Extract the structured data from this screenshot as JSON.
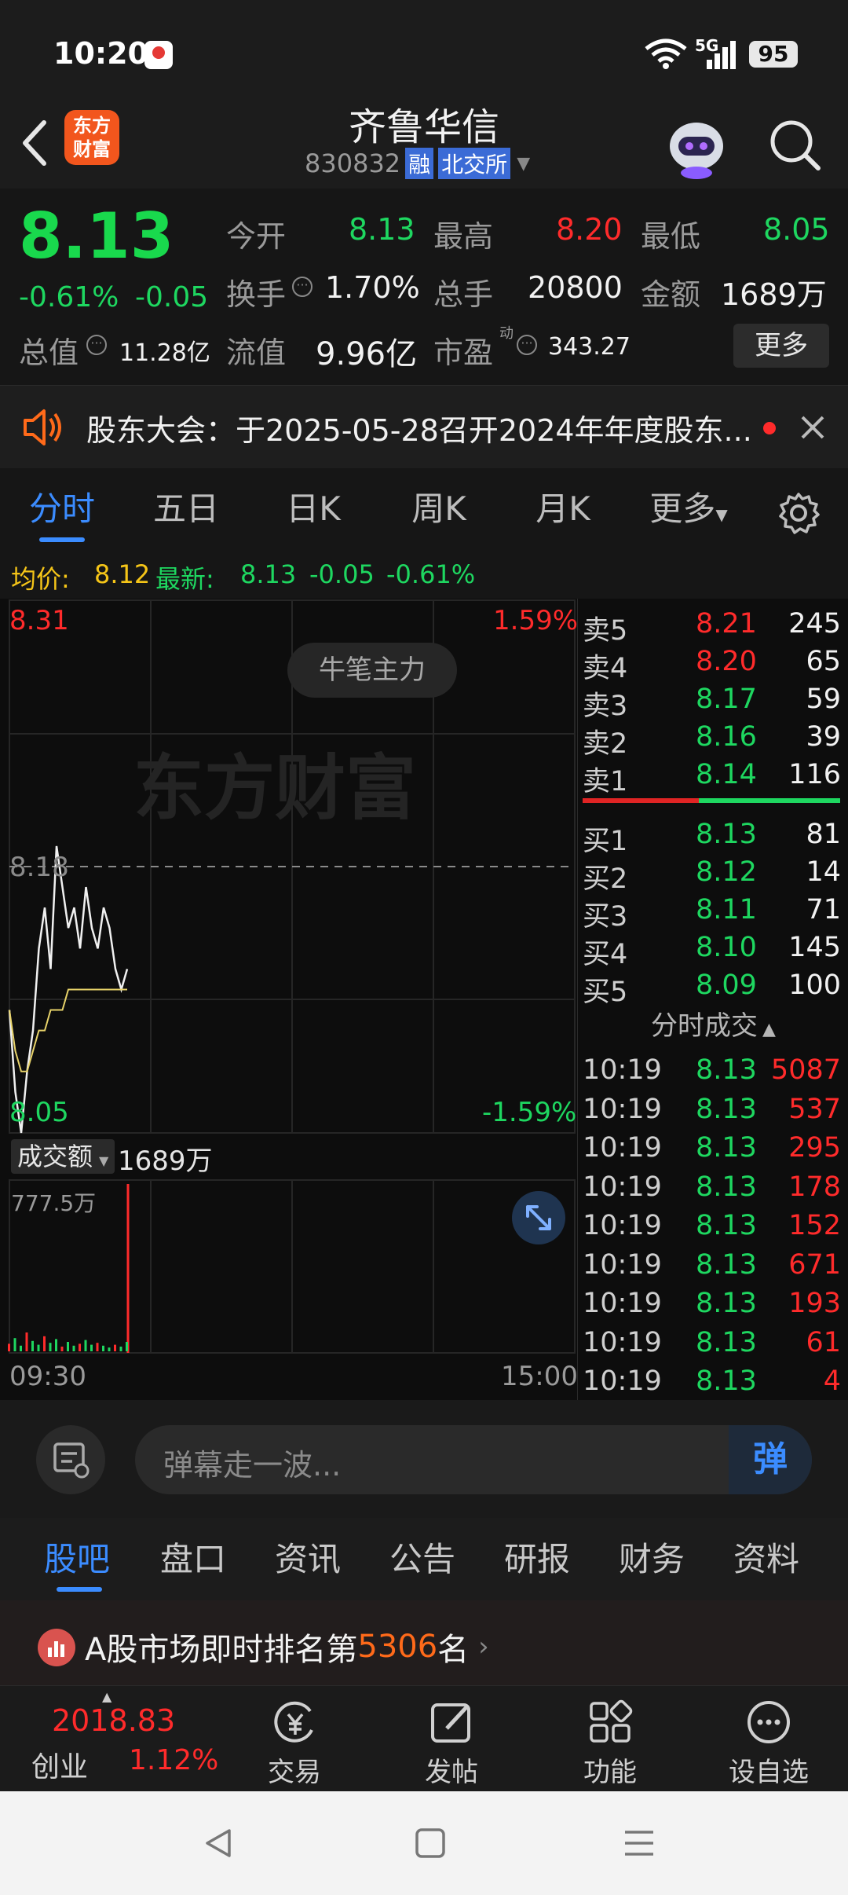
{
  "status_bar": {
    "time": "10:20",
    "network": "5G",
    "battery": "95"
  },
  "header": {
    "logo_line1": "东方",
    "logo_line2": "财富",
    "stock_name": "齐鲁华信",
    "stock_code": "830832",
    "badge_rong": "融",
    "badge_exchange": "北交所"
  },
  "quote": {
    "price": "8.13",
    "change_pct": "-0.61%",
    "change_amt": "-0.05",
    "open_label": "今开",
    "open": "8.13",
    "high_label": "最高",
    "high": "8.20",
    "low_label": "最低",
    "low": "8.05",
    "turnover_label": "换手",
    "turnover": "1.70%",
    "volume_label": "总手",
    "volume": "20800",
    "amount_label": "金额",
    "amount": "1689万",
    "total_value_label": "总值",
    "total_value": "11.28亿",
    "float_value_label": "流值",
    "float_value": "9.96亿",
    "pe_label": "市盈",
    "pe_sup": "动",
    "pe": "343.27",
    "more_button": "更多"
  },
  "notice": {
    "text": "股东大会：于2025-05-28召开2024年年度股东..."
  },
  "chart_tabs": [
    "分时",
    "五日",
    "日K",
    "周K",
    "月K",
    "更多"
  ],
  "avg_line": {
    "avg_label": "均价:",
    "avg": "8.12",
    "latest_label": "最新:",
    "latest": "8.13",
    "change": "-0.05",
    "pct": "-0.61%"
  },
  "chart": {
    "top_price": "8.31",
    "top_pct": "1.59%",
    "mid_price": "8.18",
    "bottom_price": "8.05",
    "bottom_pct": "-1.59%",
    "badge": "牛笔主力",
    "watermark": "东方财富",
    "vol_selector": "成交额",
    "vol_total": "1689万",
    "vol_max": "777.5万",
    "time_start": "09:30",
    "time_end": "15:00"
  },
  "chart_data": {
    "type": "line",
    "series": [
      {
        "values": [
          8.11,
          8.07,
          8.05,
          8.08,
          8.1,
          8.14,
          8.16,
          8.13,
          8.19,
          8.17,
          8.15,
          8.16,
          8.14,
          8.17,
          8.15,
          8.14,
          8.16,
          8.15,
          8.13,
          8.12,
          8.13
        ]
      },
      {
        "values": [
          8.11,
          8.09,
          8.08,
          8.08,
          8.09,
          8.1,
          8.1,
          8.11,
          8.11,
          8.11,
          8.12,
          8.12,
          8.12,
          8.12,
          8.12,
          8.12,
          8.12,
          8.12,
          8.12,
          8.12,
          8.12
        ]
      }
    ],
    "ylim": [
      8.05,
      8.31
    ],
    "volume": [
      80,
      140,
      60,
      200,
      110,
      70,
      160,
      90,
      130,
      50,
      100,
      60,
      80,
      120,
      70,
      90,
      60,
      40,
      70,
      50,
      100
    ]
  },
  "orderbook": {
    "asks": [
      {
        "label": "卖5",
        "price": "8.21",
        "qty": "245",
        "c": "red"
      },
      {
        "label": "卖4",
        "price": "8.20",
        "qty": "65",
        "c": "red"
      },
      {
        "label": "卖3",
        "price": "8.17",
        "qty": "59",
        "c": "green"
      },
      {
        "label": "卖2",
        "price": "8.16",
        "qty": "39",
        "c": "green"
      },
      {
        "label": "卖1",
        "price": "8.14",
        "qty": "116",
        "c": "green"
      }
    ],
    "bids": [
      {
        "label": "买1",
        "price": "8.13",
        "qty": "81"
      },
      {
        "label": "买2",
        "price": "8.12",
        "qty": "14"
      },
      {
        "label": "买3",
        "price": "8.11",
        "qty": "71"
      },
      {
        "label": "买4",
        "price": "8.10",
        "qty": "145"
      },
      {
        "label": "买5",
        "price": "8.09",
        "qty": "100"
      }
    ],
    "trades_title": "分时成交",
    "trades": [
      {
        "t": "10:19",
        "p": "8.13",
        "q": "5087"
      },
      {
        "t": "10:19",
        "p": "8.13",
        "q": "537"
      },
      {
        "t": "10:19",
        "p": "8.13",
        "q": "295"
      },
      {
        "t": "10:19",
        "p": "8.13",
        "q": "178"
      },
      {
        "t": "10:19",
        "p": "8.13",
        "q": "152"
      },
      {
        "t": "10:19",
        "p": "8.13",
        "q": "671"
      },
      {
        "t": "10:19",
        "p": "8.13",
        "q": "193"
      },
      {
        "t": "10:19",
        "p": "8.13",
        "q": "61"
      },
      {
        "t": "10:19",
        "p": "8.13",
        "q": "4"
      }
    ]
  },
  "comment": {
    "placeholder": "弹幕走一波...",
    "send_label": "弹"
  },
  "sub_tabs": [
    "股吧",
    "盘口",
    "资讯",
    "公告",
    "研报",
    "财务",
    "资料"
  ],
  "rank": {
    "prefix": "A股市场即时排名第",
    "rank": "5306",
    "suffix": "名"
  },
  "bottom_bar": {
    "index_value": "2018.83",
    "index_name": "创业",
    "index_pct": "1.12%",
    "trade": "交易",
    "post": "发帖",
    "func": "功能",
    "watch": "设自选"
  }
}
